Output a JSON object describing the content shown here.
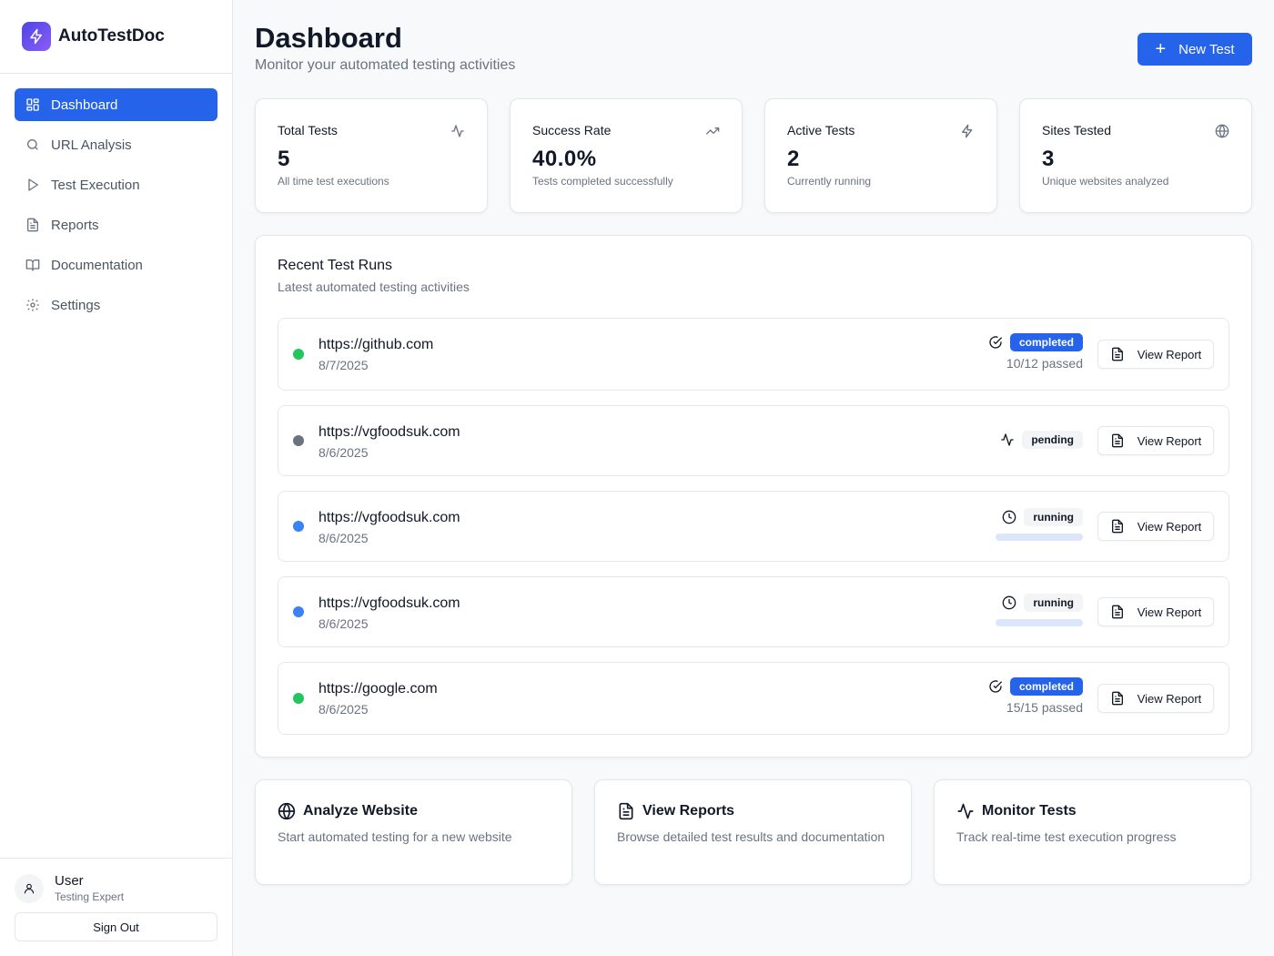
{
  "brand": {
    "name": "AutoTestDoc",
    "icon": "lightning-icon"
  },
  "sidebar": {
    "items": [
      {
        "label": "Dashboard",
        "icon": "grid-icon",
        "active": true
      },
      {
        "label": "URL Analysis",
        "icon": "search-icon"
      },
      {
        "label": "Test Execution",
        "icon": "play-icon"
      },
      {
        "label": "Reports",
        "icon": "file-text-icon"
      },
      {
        "label": "Documentation",
        "icon": "book-icon"
      },
      {
        "label": "Settings",
        "icon": "gear-icon"
      }
    ],
    "user": {
      "name": "User",
      "role": "Testing Expert"
    },
    "signout_label": "Sign Out"
  },
  "header": {
    "title": "Dashboard",
    "subtitle": "Monitor your automated testing activities",
    "new_test_label": "New Test"
  },
  "stats": [
    {
      "label": "Total Tests",
      "value": "5",
      "desc": "All time test executions",
      "icon": "activity-icon"
    },
    {
      "label": "Success Rate",
      "value": "40.0%",
      "desc": "Tests completed successfully",
      "icon": "trending-up-icon"
    },
    {
      "label": "Active Tests",
      "value": "2",
      "desc": "Currently running",
      "icon": "lightning-icon"
    },
    {
      "label": "Sites Tested",
      "value": "3",
      "desc": "Unique websites analyzed",
      "icon": "globe-icon"
    }
  ],
  "recent": {
    "title": "Recent Test Runs",
    "subtitle": "Latest automated testing activities",
    "view_report_label": "View Report",
    "runs": [
      {
        "url": "https://github.com",
        "date": "8/7/2025",
        "status": "completed",
        "passed": "10/12 passed",
        "dot_color": "#22c55e",
        "status_icon": "check-circle-icon"
      },
      {
        "url": "https://vgfoodsuk.com",
        "date": "8/6/2025",
        "status": "pending",
        "passed": "",
        "dot_color": "#6b7280",
        "status_icon": "activity-icon"
      },
      {
        "url": "https://vgfoodsuk.com",
        "date": "8/6/2025",
        "status": "running",
        "passed": "",
        "dot_color": "#3b82f6",
        "status_icon": "clock-icon"
      },
      {
        "url": "https://vgfoodsuk.com",
        "date": "8/6/2025",
        "status": "running",
        "passed": "",
        "dot_color": "#3b82f6",
        "status_icon": "clock-icon"
      },
      {
        "url": "https://google.com",
        "date": "8/6/2025",
        "status": "completed",
        "passed": "15/15 passed",
        "dot_color": "#22c55e",
        "status_icon": "check-circle-icon"
      }
    ]
  },
  "quick_actions": [
    {
      "title": "Analyze Website",
      "desc": "Start automated testing for a new website",
      "icon": "globe-icon"
    },
    {
      "title": "View Reports",
      "desc": "Browse detailed test results and documentation",
      "icon": "file-text-icon"
    },
    {
      "title": "Monitor Tests",
      "desc": "Track real-time test execution progress",
      "icon": "activity-icon"
    }
  ],
  "colors": {
    "accent": "#2563eb",
    "success": "#22c55e",
    "running": "#3b82f6",
    "pending": "#6b7280"
  }
}
